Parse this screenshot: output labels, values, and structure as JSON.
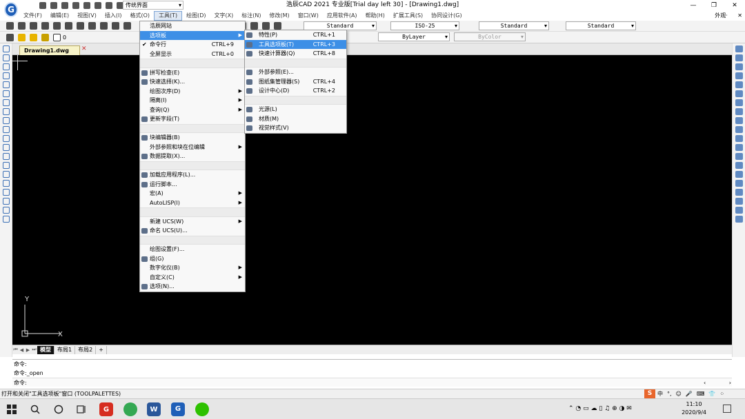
{
  "app": {
    "logo_letter": "G",
    "workspace": "传统界面",
    "window_title": "浩辰CAD 2021 专业版[Trial day left 30] - [Drawing1.dwg]",
    "window_controls": [
      "—",
      "❐",
      "✕"
    ]
  },
  "menubar": {
    "items": [
      "文件(F)",
      "编辑(E)",
      "视图(V)",
      "插入(I)",
      "格式(O)",
      "工具(T)",
      "绘图(D)",
      "文字(X)",
      "标注(N)",
      "修改(M)",
      "窗口(W)",
      "应用软件(A)",
      "帮助(H)",
      "扩展工具(S)",
      "协同设计(G)"
    ],
    "active_index": 5,
    "right_items": [
      "外观·",
      "✕"
    ]
  },
  "toolbar": {
    "text_style": "Standard",
    "dim_style": "ISO-25",
    "table_style": "Standard",
    "multileader_style": "Standard",
    "linetype": "ByLayer",
    "plotstyle": "ByColor",
    "layer_value": "0"
  },
  "tools_menu": {
    "items": [
      {
        "type": "item",
        "label": "浩辰网站"
      },
      {
        "type": "item",
        "label": "选项板",
        "submenu": true,
        "selected": true
      },
      {
        "type": "item",
        "label": "命令行",
        "accel": "CTRL+9",
        "checked": true
      },
      {
        "type": "item",
        "label": "全屏显示",
        "accel": "CTRL+0"
      },
      {
        "type": "sep"
      },
      {
        "type": "item",
        "label": "拼写检查(E)",
        "icon": true
      },
      {
        "type": "item",
        "label": "快速选择(K)...",
        "icon": true
      },
      {
        "type": "item",
        "label": "绘图次序(D)",
        "submenu": true
      },
      {
        "type": "item",
        "label": "隔离(I)",
        "submenu": true
      },
      {
        "type": "item",
        "label": "查询(Q)",
        "submenu": true
      },
      {
        "type": "item",
        "label": "更新字段(T)",
        "icon": true
      },
      {
        "type": "sep"
      },
      {
        "type": "item",
        "label": "块编辑器(B)",
        "icon": true
      },
      {
        "type": "item",
        "label": "外部参照和块在位编辑",
        "submenu": true
      },
      {
        "type": "item",
        "label": "数据提取(X)...",
        "icon": true
      },
      {
        "type": "sep"
      },
      {
        "type": "item",
        "label": "加载应用程序(L)...",
        "icon": true
      },
      {
        "type": "item",
        "label": "运行脚本...",
        "icon": true
      },
      {
        "type": "item",
        "label": "宏(A)",
        "submenu": true
      },
      {
        "type": "item",
        "label": "AutoLISP(I)",
        "submenu": true
      },
      {
        "type": "sep"
      },
      {
        "type": "item",
        "label": "新建 UCS(W)",
        "submenu": true
      },
      {
        "type": "item",
        "label": "命名 UCS(U)...",
        "icon": true
      },
      {
        "type": "sep"
      },
      {
        "type": "item",
        "label": "绘图设置(F)..."
      },
      {
        "type": "item",
        "label": "组(G)",
        "icon": true
      },
      {
        "type": "item",
        "label": "数字化仪(B)",
        "submenu": true
      },
      {
        "type": "item",
        "label": "自定义(C)",
        "submenu": true
      },
      {
        "type": "item",
        "label": "选项(N)...",
        "icon": true
      }
    ]
  },
  "palette_submenu": {
    "items": [
      {
        "type": "item",
        "label": "特性(P)",
        "accel": "CTRL+1",
        "icon": true
      },
      {
        "type": "item",
        "label": "工具选项板(T)",
        "accel": "CTRL+3",
        "icon": true,
        "selected": true
      },
      {
        "type": "item",
        "label": "快速计算器(Q)",
        "accel": "CTRL+8",
        "icon": true
      },
      {
        "type": "sep"
      },
      {
        "type": "item",
        "label": "外部参照(E)...",
        "icon": true
      },
      {
        "type": "item",
        "label": "图纸集管理器(S)",
        "accel": "CTRL+4",
        "icon": true
      },
      {
        "type": "item",
        "label": "设计中心(D)",
        "accel": "CTRL+2",
        "icon": true
      },
      {
        "type": "sep"
      },
      {
        "type": "item",
        "label": "光源(L)",
        "icon": true
      },
      {
        "type": "item",
        "label": "材质(M)",
        "icon": true
      },
      {
        "type": "item",
        "label": "视觉样式(V)",
        "icon": true
      }
    ]
  },
  "document": {
    "tab": "Drawing1.dwg",
    "ucs_y": "Y",
    "ucs_x": "X"
  },
  "layout_tabs": [
    "模型",
    "布局1",
    "布局2",
    "+"
  ],
  "command": {
    "lines": [
      "命令:",
      "命令:_open"
    ],
    "prompt": "命令:"
  },
  "statusbar": {
    "text": "打开和关闭\"工具选项板\"窗口 (TOOLPALETTES)"
  },
  "ime": {
    "logo": "S",
    "items": [
      "中",
      "°,",
      "☺",
      "🎤",
      "⌨",
      "👕",
      "⁘"
    ]
  },
  "taskbar": {
    "time": "11:10",
    "date": "2020/9/4"
  },
  "colors": {
    "canvas": "#000000",
    "menu_highlight": "#3d8fe6",
    "app_blue": "#1f5fb8"
  }
}
